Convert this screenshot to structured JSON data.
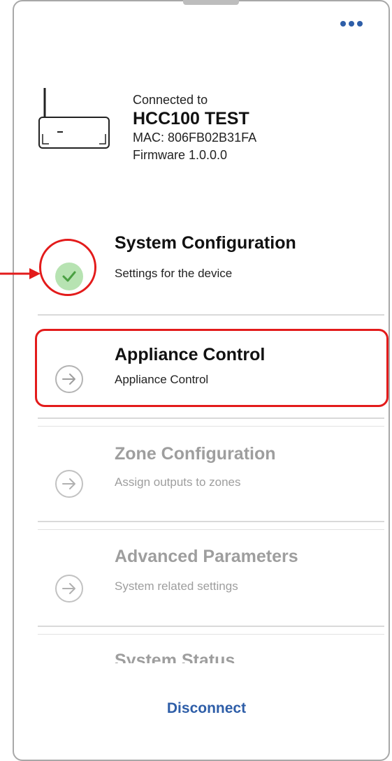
{
  "device": {
    "connected_label": "Connected to",
    "name": "HCC100 TEST",
    "mac": "MAC: 806FB02B31FA",
    "firmware": "Firmware 1.0.0.0",
    "icon": "router-icon"
  },
  "menu": {
    "icon": "more-horizontal-icon"
  },
  "steps": [
    {
      "title": "System Configuration",
      "subtitle": "Settings for the device",
      "state": "completed",
      "icon": "check-circle-icon"
    },
    {
      "title": "Appliance Control",
      "subtitle": "Appliance Control",
      "state": "active",
      "icon": "arrow-right-circle-icon"
    },
    {
      "title": "Zone Configuration",
      "subtitle": "Assign outputs to zones",
      "state": "disabled",
      "icon": "arrow-right-circle-icon"
    },
    {
      "title": "Advanced Parameters",
      "subtitle": "System related settings",
      "state": "disabled",
      "icon": "arrow-right-circle-icon"
    },
    {
      "title": "System Status",
      "subtitle": "",
      "state": "disabled",
      "icon": "arrow-right-circle-icon"
    }
  ],
  "actions": {
    "disconnect_label": "Disconnect"
  },
  "annotation_colors": {
    "highlight": "#e31b1b",
    "accent": "#2e5ea8",
    "success": "#67bd5f"
  }
}
